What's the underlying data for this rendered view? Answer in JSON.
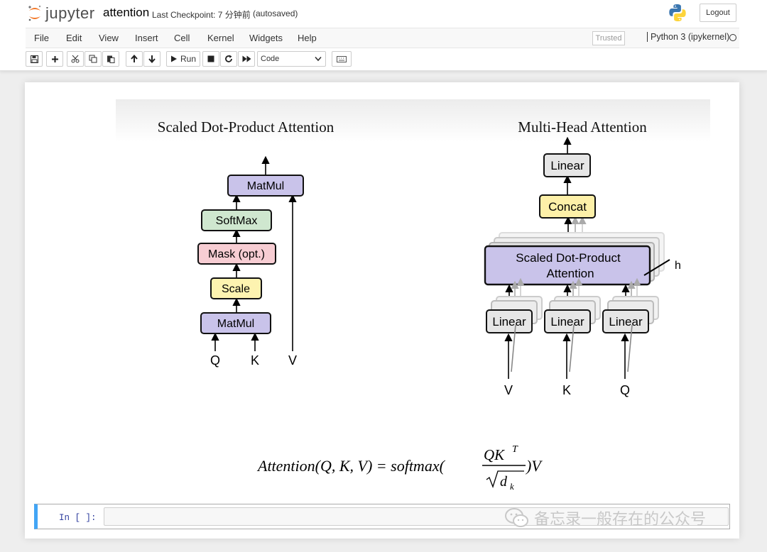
{
  "header": {
    "logo_text": "jupyter",
    "notebook_name": "attention",
    "checkpoint": "Last Checkpoint: 7 分钟前",
    "autosave": "(autosaved)",
    "logout_label": "Logout"
  },
  "menubar": {
    "items": [
      "File",
      "Edit",
      "View",
      "Insert",
      "Cell",
      "Kernel",
      "Widgets",
      "Help"
    ],
    "trusted": "Trusted",
    "kernel": "Python 3 (ipykernel)"
  },
  "toolbar": {
    "run_label": "Run",
    "cell_type": "Code",
    "icons": [
      "save-icon",
      "plus-icon",
      "cut-icon",
      "copy-icon",
      "paste-icon",
      "arrow-up-icon",
      "arrow-down-icon",
      "run-icon",
      "stop-icon",
      "restart-icon",
      "fast-forward-icon",
      "keyboard-icon"
    ]
  },
  "figure": {
    "left_title": "Scaled Dot-Product Attention",
    "right_title": "Multi-Head Attention",
    "sdpa_boxes": {
      "matmul_top": "MatMul",
      "softmax": "SoftMax",
      "mask": "Mask (opt.)",
      "scale": "Scale",
      "matmul_bottom": "MatMul"
    },
    "sdpa_inputs": [
      "Q",
      "K",
      "V"
    ],
    "mha_boxes": {
      "linear_top": "Linear",
      "concat": "Concat",
      "sdpa_line1": "Scaled Dot-Product",
      "sdpa_line2": "Attention",
      "linear_bottom": [
        "Linear",
        "Linear",
        "Linear"
      ]
    },
    "mha_h_label": "h",
    "mha_inputs": [
      "V",
      "K",
      "Q"
    ],
    "formula": {
      "lhs": "Attention(Q, K, V) = softmax(",
      "numerator": "QK",
      "numerator_sup": "T",
      "denominator": "d",
      "denominator_sub": "k",
      "rhs": ")V"
    },
    "colors": {
      "matmul": "#c9c3ea",
      "softmax": "#cfe7cf",
      "mask": "#f7cdd3",
      "scale": "#fdf3b0",
      "linear": "#e6e6e6",
      "concat": "#fdf0a8"
    }
  },
  "cell": {
    "prompt": "In [ ]:"
  },
  "watermark": "备忘录一般存在的公众号"
}
